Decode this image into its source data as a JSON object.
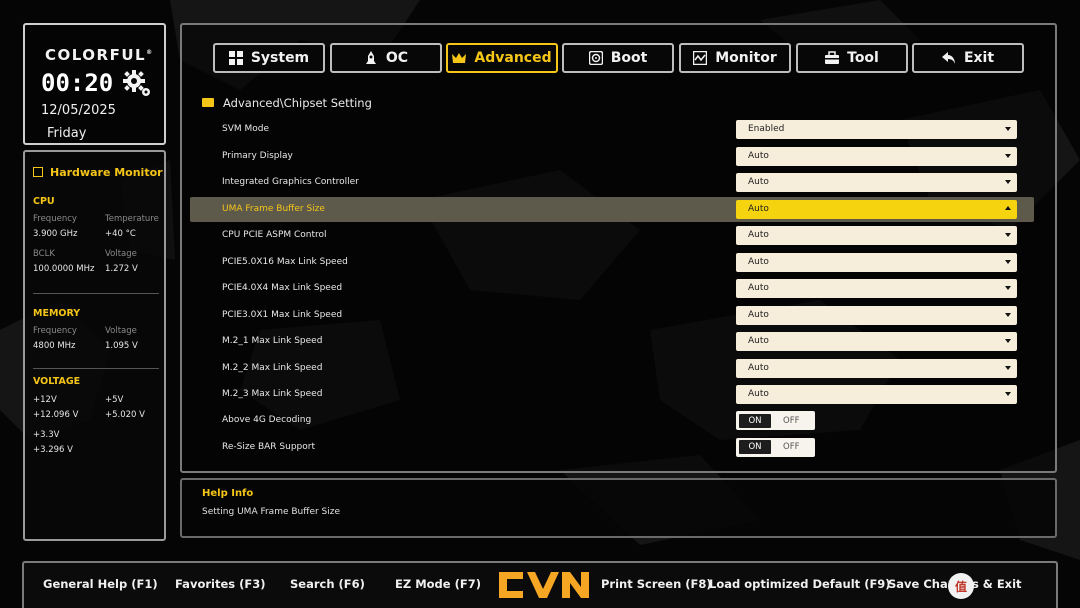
{
  "brand": "COLORFUL",
  "clock": {
    "time": "00:20",
    "date": "12/05/2025",
    "day": "Friday"
  },
  "hardware_monitor": {
    "title": "Hardware Monitor",
    "cpu": {
      "title": "CPU",
      "frequency_label": "Frequency",
      "frequency": "3.900 GHz",
      "temperature_label": "Temperature",
      "temperature": "+40 °C",
      "bclk_label": "BCLK",
      "bclk": "100.0000 MHz",
      "voltage_label": "Voltage",
      "voltage": "1.272 V"
    },
    "memory": {
      "title": "MEMORY",
      "frequency_label": "Frequency",
      "frequency": "4800 MHz",
      "voltage_label": "Voltage",
      "voltage": "1.095 V"
    },
    "voltage": {
      "title": "VOLTAGE",
      "v12_label": "+12V",
      "v12": "+12.096 V",
      "v5_label": "+5V",
      "v5": "+5.020 V",
      "v33_label": "+3.3V",
      "v33": "+3.296 V"
    }
  },
  "tabs": [
    {
      "label": "System",
      "icon": "grid-icon"
    },
    {
      "label": "OC",
      "icon": "rocket-icon"
    },
    {
      "label": "Advanced",
      "icon": "crown-icon",
      "active": true
    },
    {
      "label": "Boot",
      "icon": "disk-icon"
    },
    {
      "label": "Monitor",
      "icon": "monitor-icon"
    },
    {
      "label": "Tool",
      "icon": "toolbox-icon"
    },
    {
      "label": "Exit",
      "icon": "back-arrow-icon"
    }
  ],
  "breadcrumb": "Advanced\\Chipset Setting",
  "settings": [
    {
      "name": "SVM Mode",
      "value": "Enabled",
      "type": "dropdown"
    },
    {
      "name": "Primary Display",
      "value": "Auto",
      "type": "dropdown"
    },
    {
      "name": "Integrated Graphics Controller",
      "value": "Auto",
      "type": "dropdown"
    },
    {
      "name": "UMA Frame Buffer Size",
      "value": "Auto",
      "type": "dropdown",
      "selected": true
    },
    {
      "name": "CPU PCIE ASPM Control",
      "value": "Auto",
      "type": "dropdown"
    },
    {
      "name": "PCIE5.0X16 Max Link Speed",
      "value": "Auto",
      "type": "dropdown"
    },
    {
      "name": "PCIE4.0X4 Max Link Speed",
      "value": "Auto",
      "type": "dropdown"
    },
    {
      "name": "PCIE3.0X1 Max Link Speed",
      "value": "Auto",
      "type": "dropdown"
    },
    {
      "name": "M.2_1 Max Link Speed",
      "value": "Auto",
      "type": "dropdown"
    },
    {
      "name": "M.2_2 Max Link Speed",
      "value": "Auto",
      "type": "dropdown"
    },
    {
      "name": "M.2_3 Max Link Speed",
      "value": "Auto",
      "type": "dropdown"
    },
    {
      "name": "Above 4G Decoding",
      "type": "toggle",
      "on_label": "ON",
      "off_label": "OFF",
      "value": "ON"
    },
    {
      "name": "Re-Size BAR Support",
      "type": "toggle",
      "on_label": "ON",
      "off_label": "OFF",
      "value": "ON"
    }
  ],
  "help": {
    "title": "Help Info",
    "text": "Setting UMA Frame Buffer Size"
  },
  "function_keys": [
    "General Help (F1)",
    "Favorites (F3)",
    "Search (F6)",
    "EZ Mode (F7)",
    "Print Screen (F8)",
    "Load optimized Default (F9)",
    "Save Changes & Exit"
  ],
  "colors": {
    "accent": "#f5c518",
    "background": "#050505",
    "field": "#f7eddb",
    "selected_row": "#5d5a4c"
  }
}
